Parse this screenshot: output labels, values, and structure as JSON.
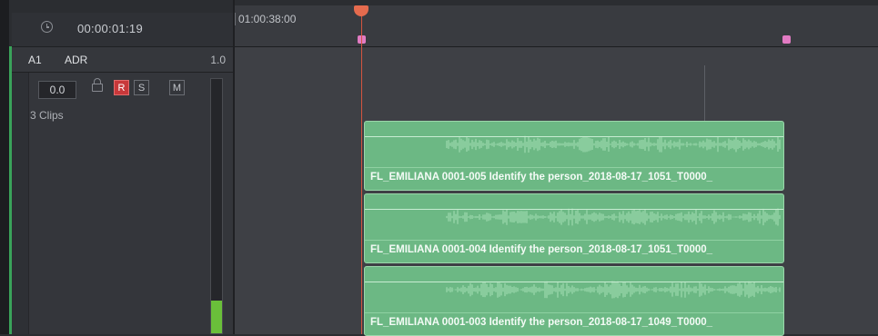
{
  "header": {
    "timecode": "00:00:01:19",
    "clock_icon": "clock-icon"
  },
  "track": {
    "id": "A1",
    "name": "ADR",
    "volume_readout": "1.0",
    "volume_field": "0.0",
    "record_label": "R",
    "solo_label": "S",
    "mute_label": "M",
    "clips_label": "3 Clips",
    "meter_level": 0.13
  },
  "ruler": {
    "timecode_label": "01:00:38:00"
  },
  "colors": {
    "clip": "#6cb884",
    "record": "#c8383a",
    "playhead": "#e56b4e",
    "marker": "#e27bc3",
    "meter": "#6abf3a"
  },
  "clips": [
    {
      "name": "FL_EMILIANA 0001-005 Identify the person_2018-08-17_1051_T0000_"
    },
    {
      "name": "FL_EMILIANA 0001-004 Identify the person_2018-08-17_1051_T0000_"
    },
    {
      "name": "FL_EMILIANA 0001-003 Identify the person_2018-08-17_1049_T0000_"
    }
  ]
}
